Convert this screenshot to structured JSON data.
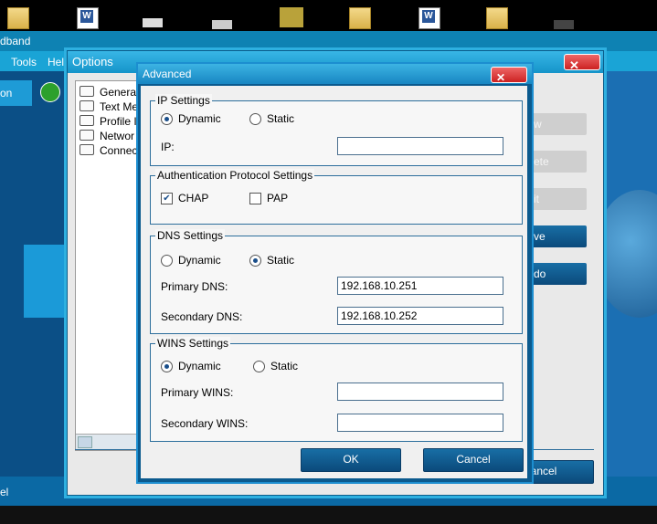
{
  "background_app": {
    "title": "dband",
    "menu": [
      "Tools",
      "Hel"
    ],
    "left_button": "on",
    "bottom_left": "el"
  },
  "options_window": {
    "title": "Options",
    "close_glyph": "✕",
    "tree_items": [
      "General",
      "Text Me",
      "Profile I",
      "Networ",
      "Connec"
    ],
    "side_buttons": [
      "w",
      "ete",
      "it",
      "ve",
      "do"
    ],
    "cancel_partial": "ancel"
  },
  "advanced_dialog": {
    "title": "Advanced",
    "close_glyph": "✕",
    "ip_settings": {
      "legend": "IP Settings",
      "dynamic_label": "Dynamic",
      "static_label": "Static",
      "selected": "Dynamic",
      "ip_label": "IP:",
      "ip_value": ""
    },
    "auth_settings": {
      "legend": "Authentication Protocol Settings",
      "chap_label": "CHAP",
      "chap_checked": true,
      "pap_label": "PAP",
      "pap_checked": false
    },
    "dns_settings": {
      "legend": "DNS Settings",
      "dynamic_label": "Dynamic",
      "static_label": "Static",
      "selected": "Static",
      "primary_label": "Primary DNS:",
      "primary_value": "192.168.10.251",
      "secondary_label": "Secondary DNS:",
      "secondary_value": "192.168.10.252"
    },
    "wins_settings": {
      "legend": "WINS Settings",
      "dynamic_label": "Dynamic",
      "static_label": "Static",
      "selected": "Dynamic",
      "primary_label": "Primary WINS:",
      "primary_value": "",
      "secondary_label": "Secondary WINS:",
      "secondary_value": ""
    },
    "ok_label": "OK",
    "cancel_label": "Cancel"
  },
  "colors": {
    "dialog_frame": "#0b5a8e",
    "title_bar": "#1886c2",
    "button": "#0b4a7b",
    "app_background": "#0f8fbf"
  }
}
